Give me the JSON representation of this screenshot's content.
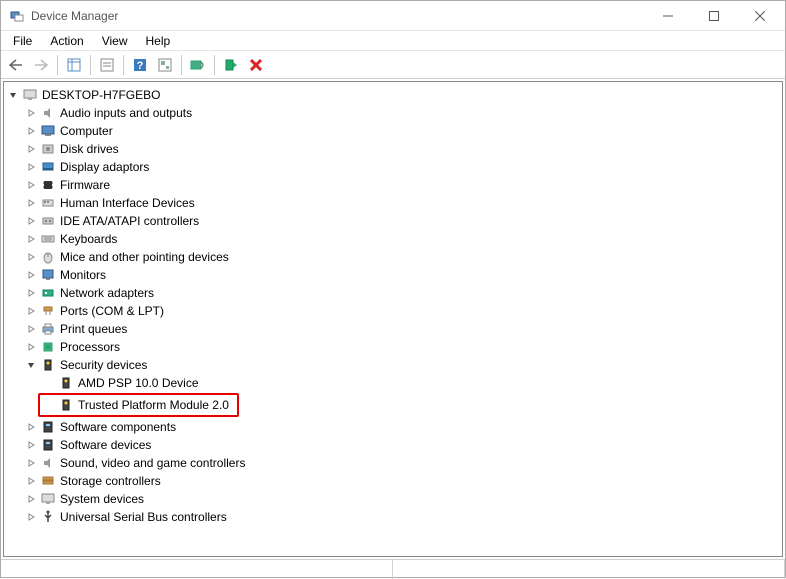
{
  "window": {
    "title": "Device Manager"
  },
  "menu": {
    "file": "File",
    "action": "Action",
    "view": "View",
    "help": "Help"
  },
  "tree": {
    "root": "DESKTOP-H7FGEBO",
    "categories": {
      "audio": "Audio inputs and outputs",
      "computer": "Computer",
      "disk": "Disk drives",
      "display": "Display adaptors",
      "firmware": "Firmware",
      "hid": "Human Interface Devices",
      "ide": "IDE ATA/ATAPI controllers",
      "keyboards": "Keyboards",
      "mice": "Mice and other pointing devices",
      "monitors": "Monitors",
      "network": "Network adapters",
      "ports": "Ports (COM & LPT)",
      "printq": "Print queues",
      "processors": "Processors",
      "security": "Security devices",
      "swcomp": "Software components",
      "swdev": "Software devices",
      "sound": "Sound, video and game controllers",
      "storage": "Storage controllers",
      "system": "System devices",
      "usb": "Universal Serial Bus controllers"
    },
    "security_children": {
      "amd_psp": "AMD PSP 10.0 Device",
      "tpm": "Trusted Platform Module 2.0"
    }
  }
}
